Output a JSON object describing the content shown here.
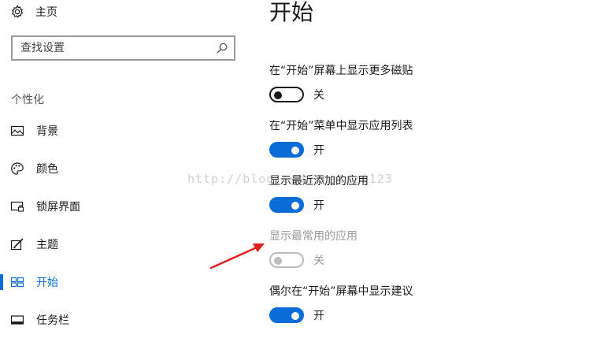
{
  "sidebar": {
    "home_label": "主页",
    "search_placeholder": "查找设置",
    "section_label": "个性化",
    "items": [
      {
        "label": "背景",
        "icon": "picture-icon"
      },
      {
        "label": "颜色",
        "icon": "palette-icon"
      },
      {
        "label": "锁屏界面",
        "icon": "lock-screen-icon"
      },
      {
        "label": "主题",
        "icon": "theme-brush-icon"
      },
      {
        "label": "开始",
        "icon": "start-tiles-icon",
        "active": true
      },
      {
        "label": "任务栏",
        "icon": "taskbar-icon"
      }
    ]
  },
  "main": {
    "title": "开始",
    "settings": [
      {
        "label": "在“开始”屏幕上显示更多磁贴",
        "state": "关",
        "on": false,
        "disabled": false
      },
      {
        "label": "在“开始”菜单中显示应用列表",
        "state": "开",
        "on": true,
        "disabled": false
      },
      {
        "label": "显示最近添加的应用",
        "state": "开",
        "on": true,
        "disabled": false
      },
      {
        "label": "显示最常用的应用",
        "state": "关",
        "on": false,
        "disabled": true
      },
      {
        "label": "偶尔在“开始”屏幕中显示建议",
        "state": "开",
        "on": true,
        "disabled": false
      }
    ]
  },
  "overlay": {
    "watermark": "http://blog.csdn.net/zt123",
    "arrow_color": "#e02020"
  },
  "colors": {
    "accent": "#0a6cd6",
    "disabled": "#bbbbbb"
  }
}
